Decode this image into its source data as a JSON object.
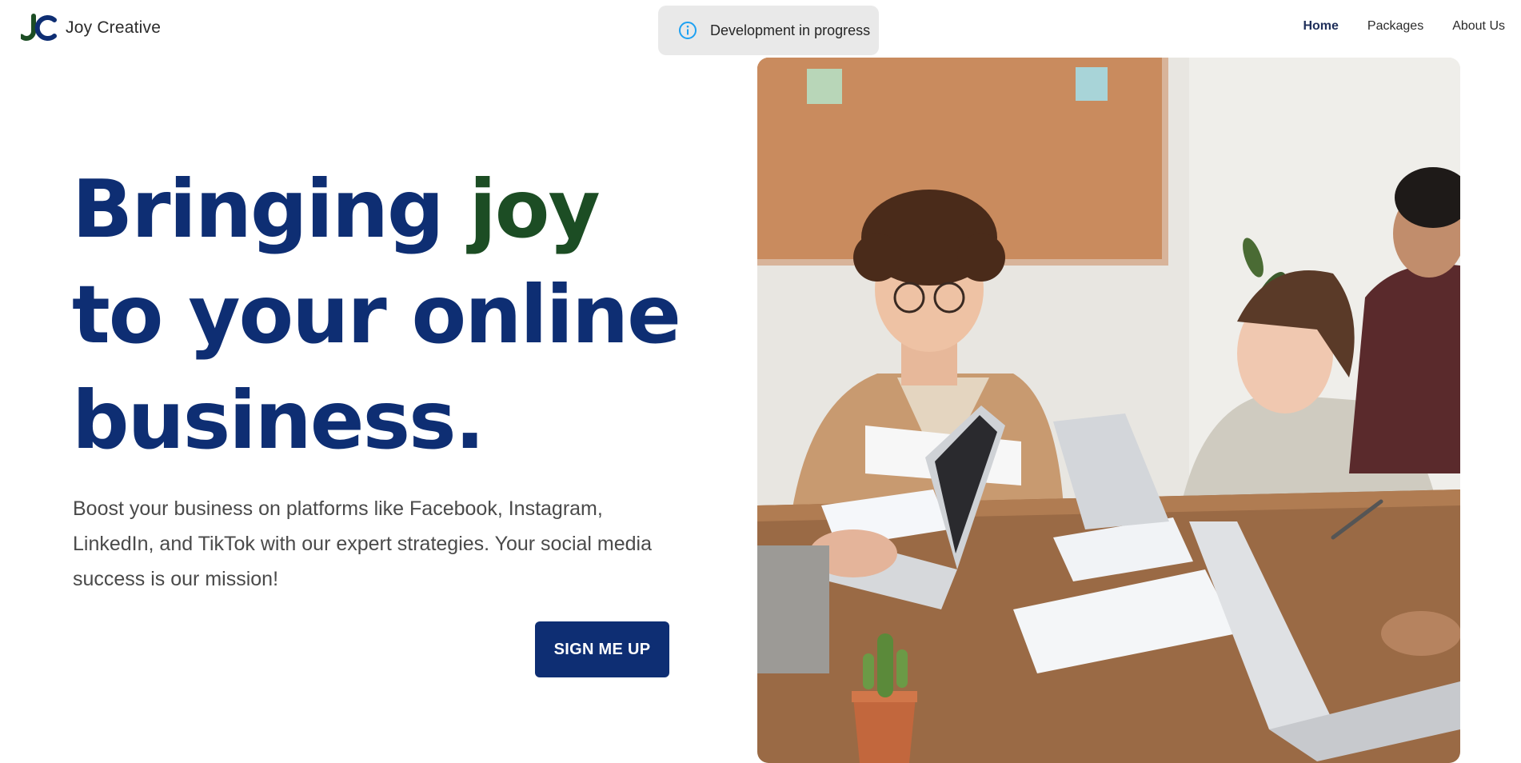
{
  "brand": {
    "name": "Joy Creative",
    "logo_letters": "JC",
    "colors": {
      "j": "#1c4d24",
      "c": "#0e2e73"
    }
  },
  "toast": {
    "text": "Development in progress",
    "icon": "info-icon",
    "icon_color": "#1ea1f2"
  },
  "nav": {
    "items": [
      {
        "label": "Home",
        "active": true
      },
      {
        "label": "Packages",
        "active": false
      },
      {
        "label": "About Us",
        "active": false
      }
    ]
  },
  "hero": {
    "title_part1": "Bringing",
    "title_accent": "joy",
    "title_line2": "to your online",
    "title_line3": "business.",
    "description": "Boost your business on platforms like Facebook, Instagram, LinkedIn, and TikTok with our expert strategies. Your social media success is our mission!",
    "cta_label": "SIGN ME UP"
  },
  "colors": {
    "primary": "#0e2e73",
    "accent": "#1c4d24",
    "toast_bg": "#e9e9e9"
  },
  "photo": {
    "subject": "team-meeting-photo"
  }
}
